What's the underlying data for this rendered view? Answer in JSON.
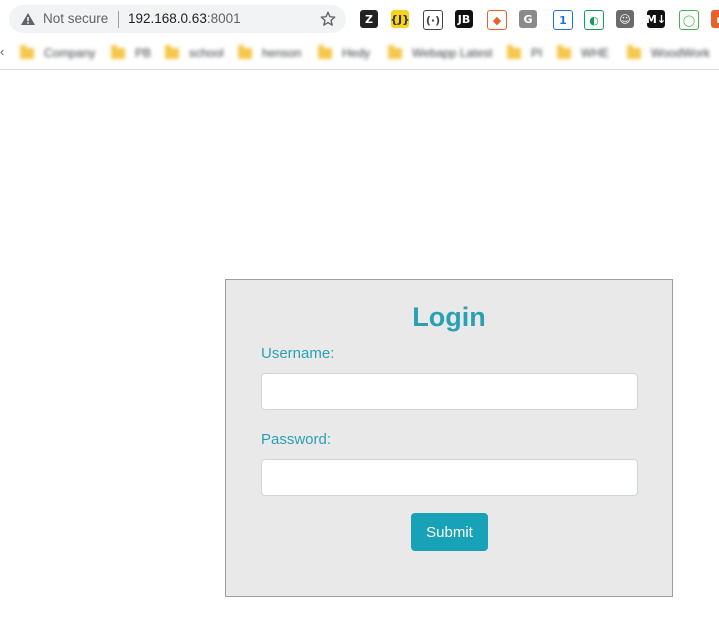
{
  "browser": {
    "security_label": "Not secure",
    "url_host": "192.168.0.63",
    "url_port": ":8001",
    "extensions": [
      {
        "name": "zotero-extension",
        "glyph": "Z",
        "bg": "#222222",
        "fg": "#ffffff"
      },
      {
        "name": "json-viewer-extension",
        "glyph": "{J}",
        "bg": "#f7d51d",
        "fg": "#333333"
      },
      {
        "name": "code-extension",
        "glyph": "(·)",
        "bg": "#ffffff",
        "fg": "#444444"
      },
      {
        "name": "jetbrains-extension",
        "glyph": "JB",
        "bg": "#111111",
        "fg": "#ffffff"
      },
      {
        "name": "git-extension",
        "glyph": "◆",
        "bg": "#ffffff",
        "fg": "#e8612c"
      },
      {
        "name": "g-extension",
        "glyph": "G",
        "bg": "#8a8a8a",
        "fg": "#ffffff"
      },
      {
        "name": "diagram-extension",
        "glyph": "1",
        "bg": "#ffffff",
        "fg": "#1a73e8"
      },
      {
        "name": "edge-extension",
        "glyph": "◐",
        "bg": "#ffffff",
        "fg": "#0f9d58"
      },
      {
        "name": "ghost-extension",
        "glyph": "☺",
        "bg": "#6b6b6b",
        "fg": "#ffffff"
      },
      {
        "name": "markdown-extension",
        "glyph": "M↓",
        "bg": "#111111",
        "fg": "#ffffff"
      },
      {
        "name": "apple-extension",
        "glyph": "◯",
        "bg": "#ffffff",
        "fg": "#4caf50"
      },
      {
        "name": "partial-extension",
        "glyph": "▪",
        "bg": "#e8612c",
        "fg": "#ffffff"
      }
    ]
  },
  "bookmarks": [
    {
      "label": "Company"
    },
    {
      "label": "PB"
    },
    {
      "label": "school"
    },
    {
      "label": "henson"
    },
    {
      "label": "Hedy"
    },
    {
      "label": "Webapp Latest"
    },
    {
      "label": "PI"
    },
    {
      "label": "WHE"
    },
    {
      "label": "WoodWork"
    }
  ],
  "login": {
    "title": "Login",
    "username_label": "Username:",
    "username_value": "",
    "password_label": "Password:",
    "password_value": "",
    "submit_label": "Submit"
  },
  "colors": {
    "accent": "#2aa0b4",
    "button": "#17a2b8",
    "panel_bg": "#e9e9e9"
  }
}
